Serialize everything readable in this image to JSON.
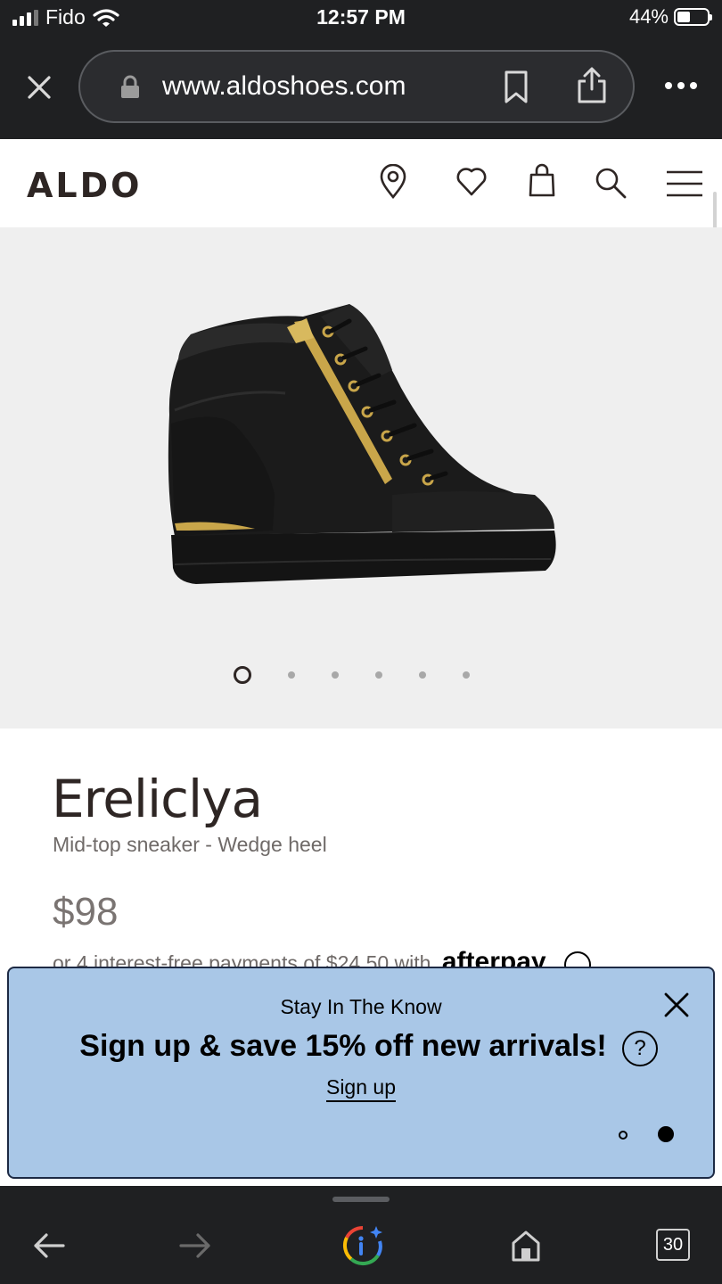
{
  "status": {
    "carrier": "Fido",
    "time": "12:57 PM",
    "battery_pct": 44,
    "battery_label": "44%"
  },
  "browser": {
    "url": "www.aldoshoes.com"
  },
  "site": {
    "logo": "ALDO"
  },
  "product": {
    "name": "Ereliclya",
    "subtitle": "Mid-top sneaker - Wedge heel",
    "price": "$98",
    "installments": "or 4 interest-free payments of $24.50 with",
    "pay_brand": "afterpay",
    "image_index": 1,
    "image_count": 6
  },
  "banner": {
    "kicker": "Stay In The Know",
    "headline": "Sign up & save 15% off new arrivals!",
    "help": "?",
    "cta": "Sign up",
    "page": 2,
    "pages": 2
  },
  "toolbar": {
    "tab_count": "30"
  }
}
